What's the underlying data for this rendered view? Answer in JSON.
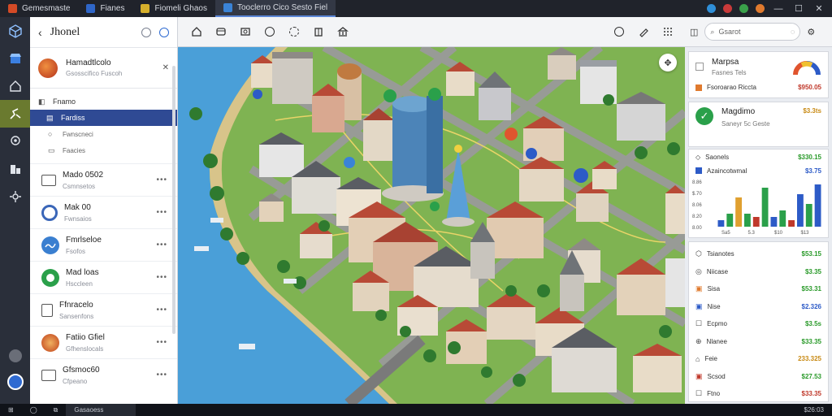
{
  "tabs": [
    {
      "label": "Gemesmaste",
      "color": "#d34a26"
    },
    {
      "label": "Fianes",
      "color": "#2f66c8"
    },
    {
      "label": "Fiomeli Ghaos",
      "color": "#d6b02c"
    },
    {
      "label": "Tooclerro Cico Sesto Fiel",
      "color": "#3a83d6"
    }
  ],
  "window_controls": {
    "minimize": "—",
    "maximize": "☐",
    "close": "✕"
  },
  "rail": [
    "cube-icon",
    "store-icon",
    "home-icon",
    "route-icon",
    "settings-icon",
    "chart-icon",
    "network-icon",
    "help-icon",
    "user-icon"
  ],
  "sidebar": {
    "title": "Jhonel",
    "profile": {
      "name": "Hamadtlcolo",
      "sub": "Gsosscifico Fuscoh",
      "close": "✕"
    },
    "nav": [
      {
        "label": "Fnamo",
        "icon": "◧",
        "active": false,
        "sub": false
      },
      {
        "label": "Fardiss",
        "icon": "▤",
        "active": true,
        "sub": false
      },
      {
        "label": "Fwnscneci",
        "icon": "○",
        "active": false,
        "sub": true
      },
      {
        "label": "Faacies",
        "icon": "▭",
        "active": false,
        "sub": true
      }
    ],
    "items": [
      {
        "title": "Mado 0502",
        "sub": "Csmnsetos",
        "thumb": "square"
      },
      {
        "title": "Mak 00",
        "sub": "Fwnsaios",
        "thumb": "ring"
      },
      {
        "title": "Fmrlseloe",
        "sub": "Fsofos",
        "thumb": "wave"
      },
      {
        "title": "Mad loas",
        "sub": "Hsccleen",
        "thumb": "green"
      },
      {
        "title": "Ffnracelo",
        "sub": "Sansenfons",
        "thumb": "doc"
      },
      {
        "title": "Fatiio Gfiel",
        "sub": "Gfhenslocals",
        "thumb": "badge"
      },
      {
        "title": "Gfsmoc60",
        "sub": "Cfpeano",
        "thumb": "square"
      }
    ],
    "more": "•••"
  },
  "search": {
    "placeholder": "Gsarot"
  },
  "map": {
    "fab": "✥"
  },
  "right_panel": {
    "card1": {
      "title": "Marpsa",
      "sub": "Fasnes Tels",
      "row": "Fsoroarao Riccta",
      "value": "$950.05"
    },
    "card2": {
      "title": "Magdimo",
      "sub": "Saneyr 5c Geste",
      "value": "$3.3ts"
    },
    "card3": {
      "label": "Saonels",
      "value": "$330.15",
      "chart_label": "Azaincotwmal",
      "chart_val": "$3.75",
      "yticks": [
        "8.86",
        "$.70",
        "8.06",
        "8.20",
        "8.00"
      ],
      "xticks": [
        "Sa5",
        "5.3",
        "$10",
        "$13"
      ]
    },
    "list": [
      {
        "icon": "⬡",
        "label": "Tsianotes",
        "value": "$53.15",
        "color": "green"
      },
      {
        "icon": "◎",
        "label": "Niicase",
        "value": "$3.35",
        "color": "green"
      },
      {
        "icon": "▣",
        "label": "Sisa",
        "value": "$53.31",
        "color": "green",
        "sq": "#e07a2e"
      },
      {
        "icon": "▣",
        "label": "Nise",
        "value": "$2.326",
        "color": "blue",
        "sq": "#2d5bc7"
      },
      {
        "icon": "☐",
        "label": "Ecpmo",
        "value": "$3.5s",
        "color": "green"
      },
      {
        "icon": "⊕",
        "label": "Nlanee",
        "value": "$33.35",
        "color": "green"
      },
      {
        "icon": "⌂",
        "label": "Feie",
        "value": "233.325",
        "color": "gold"
      },
      {
        "icon": "▣",
        "label": "Scsod",
        "value": "$27.53",
        "color": "green",
        "sq": "#c0392b"
      },
      {
        "icon": "☐",
        "label": "Ftno",
        "value": "$33.35",
        "color": "red"
      }
    ]
  },
  "taskbar": [
    {
      "label": "⊞"
    },
    {
      "label": "◯"
    },
    {
      "label": "⧉"
    },
    {
      "label": "Gasaoess",
      "box": true
    }
  ],
  "taskbar_right": "$26:03",
  "colors": {
    "accent": "#2f4a94",
    "rail_active": "#6a7a2f",
    "water": "#4a9fd8",
    "grass": "#7fb352"
  },
  "chart_data": {
    "type": "bar",
    "title": "Azaincotwmal",
    "categories": [
      "Sa5",
      "5.3",
      "$10",
      "$13"
    ],
    "series": [
      {
        "name": "",
        "values": [
          2,
          4,
          9,
          4,
          3,
          12,
          3,
          5,
          2,
          10,
          7,
          13
        ]
      }
    ],
    "ylabel": "",
    "xlabel": ""
  }
}
